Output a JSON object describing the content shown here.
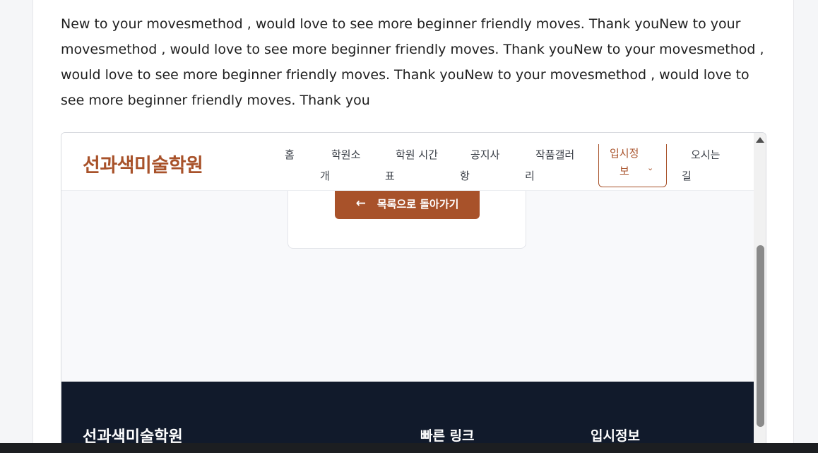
{
  "post": {
    "body": "New to your movesmethod , would love to see more beginner friendly moves. Thank youNew to your movesmethod , would love to see more beginner friendly moves. Thank youNew to your movesmethod , would love to see more beginner friendly moves. Thank youNew to your movesmethod , would love to see more beginner friendly moves. Thank you"
  },
  "site": {
    "logo": "선과색미술학원",
    "nav": [
      {
        "line1": "홈",
        "line2": ""
      },
      {
        "line1": "학원소",
        "line2": "개"
      },
      {
        "line1": "학원 시간",
        "line2": "표"
      },
      {
        "line1": "공지사",
        "line2": "항"
      },
      {
        "line1": "작품갤러",
        "line2": "리"
      },
      {
        "line1": "입시정",
        "line2": "보"
      },
      {
        "line1": "오시는",
        "line2": "길"
      }
    ],
    "back_button": "목록으로 돌아가기",
    "footer": {
      "brand": "선과색미술학원",
      "quick_links": "빠른 링크",
      "admissions": "입시정보"
    }
  },
  "colors": {
    "accent": "#a8522a",
    "footer_bg": "#111a2b"
  },
  "icons": {
    "back": "arrow-left-icon",
    "dropdown": "chevron-down-icon",
    "scroll_up": "scroll-up-arrow-icon"
  }
}
